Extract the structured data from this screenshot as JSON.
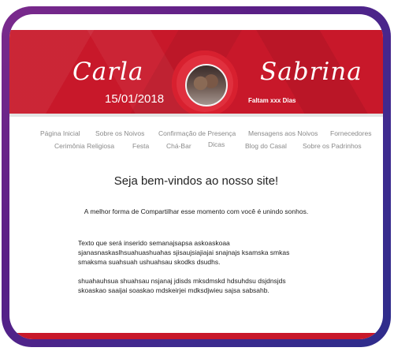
{
  "header": {
    "name_left": "Carla",
    "name_right": "Sabrina",
    "date": "15/01/2018",
    "countdown": "Faltam xxx Dias"
  },
  "nav": {
    "items": [
      "Página Inicial",
      "Sobre os Noivos",
      "Confirmação de Presença",
      "Mensagens aos Noivos",
      "Fornecedores",
      "Cerimônia Religiosa",
      "Festa",
      "Chá-Bar",
      "Dicas",
      "Blog do Casal",
      "Sobre os Padrinhos"
    ]
  },
  "content": {
    "heading": "Seja bem-vindos ao nosso site!",
    "intro": "A melhor forma de Compartilhar esse momento com você é unindo sonhos.",
    "paragraph1": "Texto que será inserido semanajsapsa askoaskoaa sjanasnaskaslhsuahuashuahas sjisaujsiajiajai snajnajs ksamska smkas smaksma suahsuah ushuahsau skodks dsudhs.",
    "paragraph2": "shuahauhsua shuahsau nsjanaj jdisds mksdmskd hdsuhdsu dsjdnsjds skoaskao saaijai soaskao mdskeirjei mdksdjwieu sajsa sabsahb."
  },
  "colors": {
    "brand_red": "#c8182a",
    "frame_purple": "#5a1f86",
    "nav_text": "#8a8a8a"
  }
}
